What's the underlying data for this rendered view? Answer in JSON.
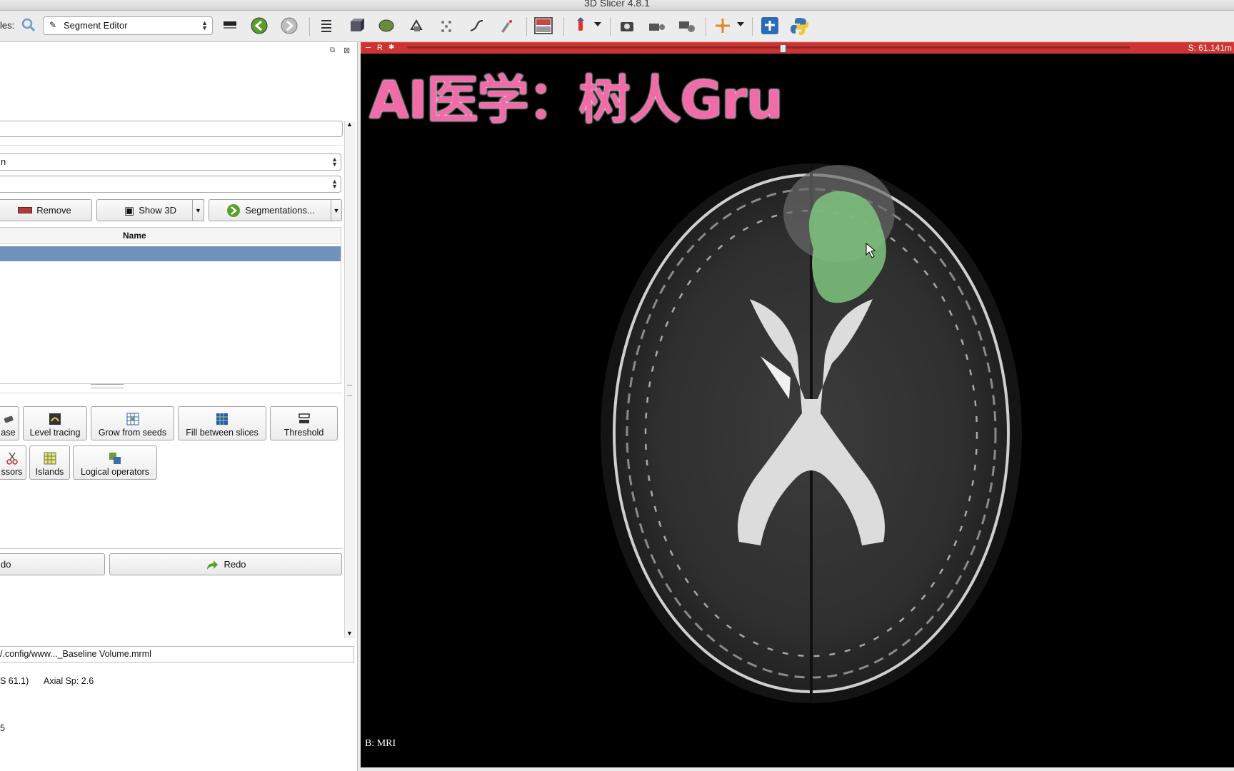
{
  "window": {
    "title": "3D Slicer 4.8.1"
  },
  "toolbar": {
    "modules_label": "les:",
    "module_selected": "Segment Editor"
  },
  "panel": {
    "master_volume_partial": "n",
    "buttons": {
      "remove": "Remove",
      "show3d": "Show 3D",
      "segmentations": "Segmentations..."
    },
    "table": {
      "column_name": "Name"
    },
    "effects_row1": [
      {
        "label": "ase",
        "icon": "erase-icon"
      },
      {
        "label": "Level tracing",
        "icon": "level-tracing-icon"
      },
      {
        "label": "Grow from seeds",
        "icon": "grow-from-seeds-icon"
      },
      {
        "label": "Fill between slices",
        "icon": "fill-between-slices-icon"
      },
      {
        "label": "Threshold",
        "icon": "threshold-icon"
      }
    ],
    "effects_row2": [
      {
        "label": "ssors",
        "icon": "scissors-icon"
      },
      {
        "label": "Islands",
        "icon": "islands-icon"
      },
      {
        "label": "Logical operators",
        "icon": "logical-operators-icon"
      }
    ],
    "undo_label": "do",
    "redo_label": "Redo",
    "scene_path": "/.config/www..._Baseline Volume.mrml",
    "coords_text": "S 61.1)",
    "spacing_text": "Axial Sp: 2.6",
    "misc_text": "5"
  },
  "viewer": {
    "header_left": "R",
    "slice_offset": "S: 61.141m",
    "slider_fraction": 0.52,
    "watermark": "AI医学：树人Gru",
    "background_label": "B: MRI",
    "colors": {
      "header": "#cc3333",
      "segment": "#7fc47f",
      "watermark": "#f26aa8"
    }
  }
}
